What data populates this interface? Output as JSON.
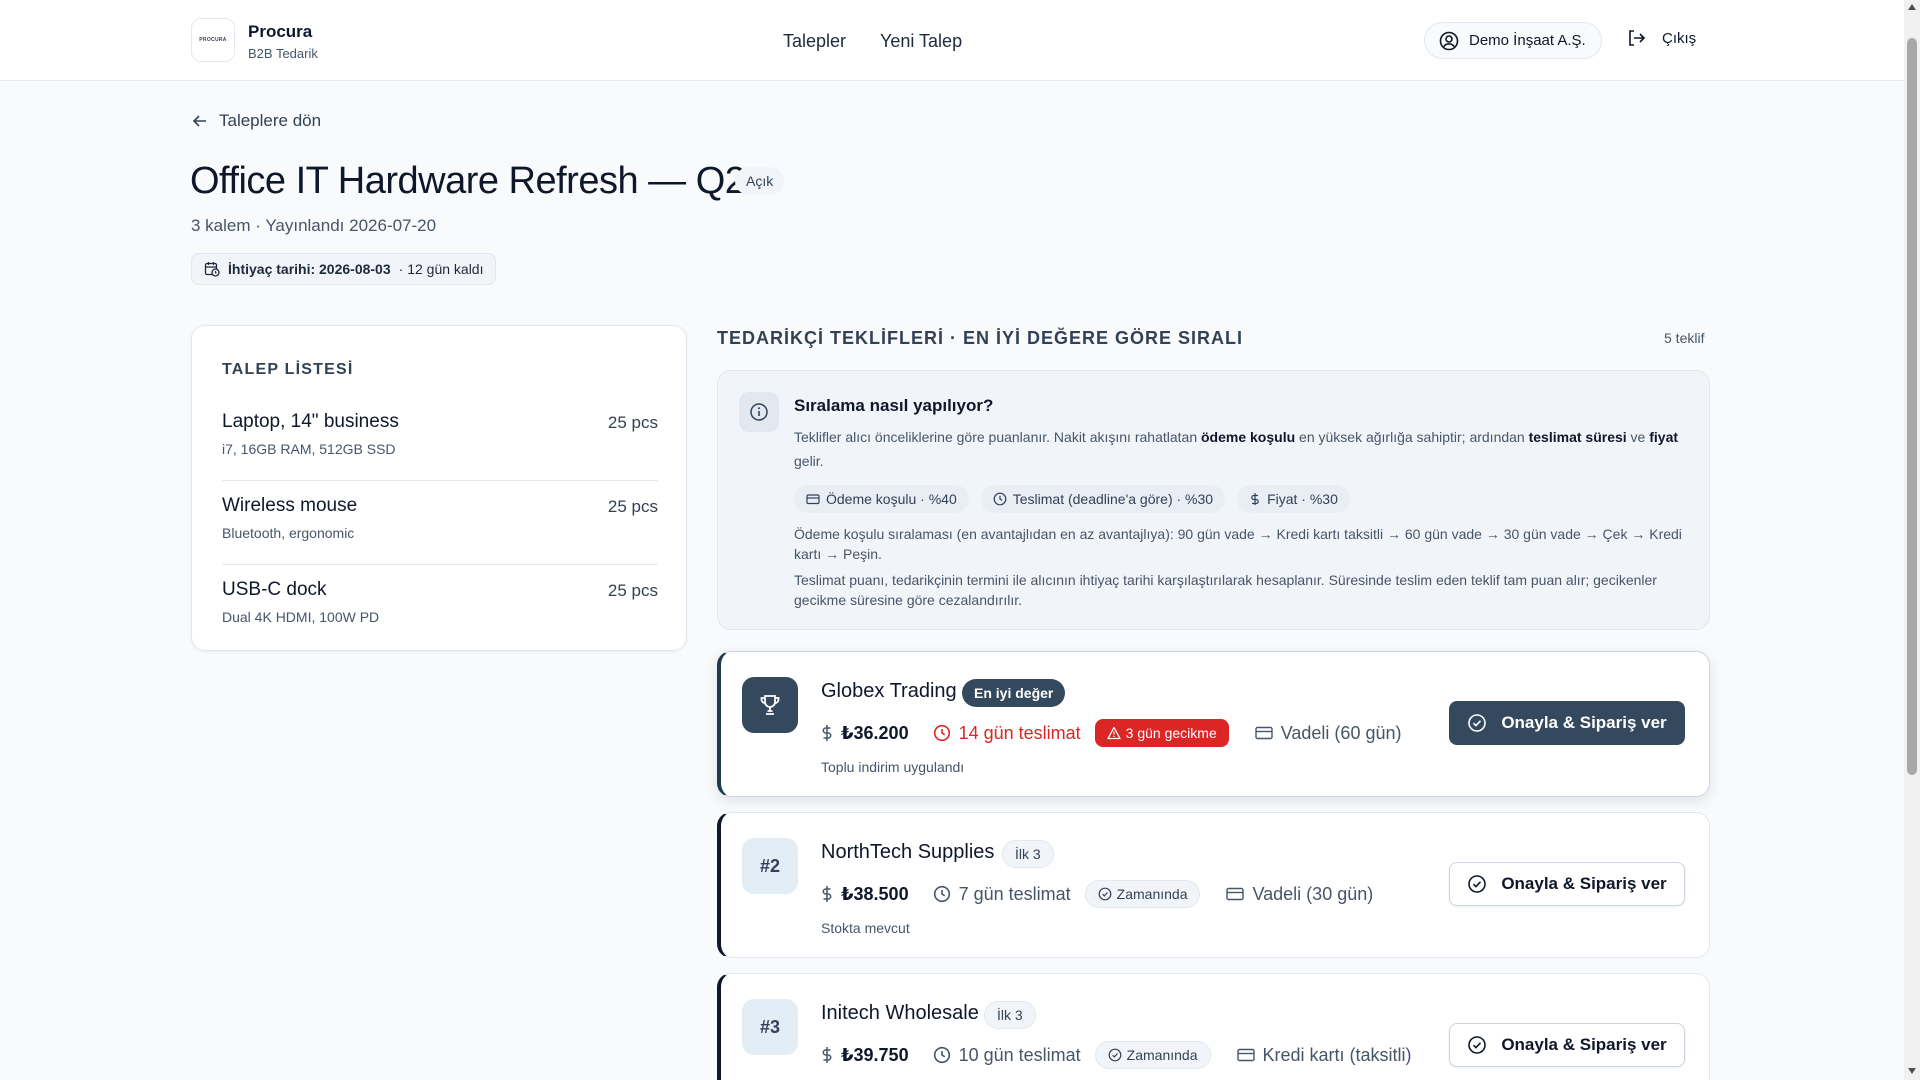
{
  "header": {
    "logo_text": "PROCURA",
    "brand": "Procura",
    "brand_sub": "B2B Tedarik",
    "nav": [
      "Talepler",
      "Yeni Talep"
    ],
    "company": "Demo İnşaat A.Ş.",
    "logout": "Çıkış"
  },
  "page": {
    "back": "Taleplere dön",
    "title": "Office IT Hardware Refresh — Q2",
    "status": "Açık",
    "meta": "3 kalem · Yayınlandı 2026-07-20",
    "deadline_label": "İhtiyaç tarihi: 2026-08-03",
    "deadline_remaining": "· 12 gün kaldı"
  },
  "request_list": {
    "heading": "TALEP LİSTESİ",
    "items": [
      {
        "name": "Laptop, 14\" business",
        "spec": "i7, 16GB RAM, 512GB SSD",
        "qty": "25 pcs"
      },
      {
        "name": "Wireless mouse",
        "spec": "Bluetooth, ergonomic",
        "qty": "25 pcs"
      },
      {
        "name": "USB-C dock",
        "spec": "Dual 4K HDMI, 100W PD",
        "qty": "25 pcs"
      }
    ]
  },
  "offers": {
    "heading": "TEDARİKÇİ TEKLİFLERİ · EN İYİ DEĞERE GÖRE SIRALI",
    "count": "5 teklif",
    "info": {
      "title": "Sıralama nasıl yapılıyor?",
      "t1": "Teklifler alıcı önceliklerine göre puanlanır. Nakit akışını rahatlatan ",
      "b1": "ödeme koşulu",
      "t2": " en yüksek ağırlığa sahiptir; ardından ",
      "b2": "teslimat süresi",
      "t3": " ve ",
      "b3": "fiyat",
      "t4": " gelir.",
      "weights": [
        "Ödeme koşulu · %40",
        "Teslimat (deadline'a göre) · %30",
        "Fiyat · %30"
      ],
      "p1": "Ödeme koşulu sıralaması (en avantajlıdan en az avantajlıya): 90 gün vade → Kredi kartı taksitli → 60 gün vade → 30 gün vade → Çek → Kredi kartı → Peşin.",
      "p2": "Teslimat puanı, tedarikçinin termini ile alıcının ihtiyaç tarihi karşılaştırılarak hesaplanır. Süresinde teslim eden teklif tam puan alır; gecikenler gecikme süresine göre cezalandırılır."
    },
    "cards": [
      {
        "rank": "",
        "name": "Globex Trading",
        "tag": "En iyi değer",
        "price": "₺36.200",
        "delivery": "14 gün teslimat",
        "delivery_status": "3 gün gecikme",
        "payment": "Vadeli (60 gün)",
        "note": "Toplu indirim uygulandı",
        "action": "Onayla & Sipariş ver"
      },
      {
        "rank": "#2",
        "name": "NorthTech Supplies",
        "tag": "İlk 3",
        "price": "₺38.500",
        "delivery": "7 gün teslimat",
        "delivery_status": "Zamanında",
        "payment": "Vadeli (30 gün)",
        "note": "Stokta mevcut",
        "action": "Onayla & Sipariş ver"
      },
      {
        "rank": "#3",
        "name": "Initech Wholesale",
        "tag": "İlk 3",
        "price": "₺39.750",
        "delivery": "10 gün teslimat",
        "delivery_status": "Zamanında",
        "payment": "Kredi kartı (taksitli)",
        "action": "Onayla & Sipariş ver"
      }
    ]
  },
  "colors": {
    "accent": "#34495e",
    "danger": "#dc2626",
    "background": "#f8fafc"
  }
}
